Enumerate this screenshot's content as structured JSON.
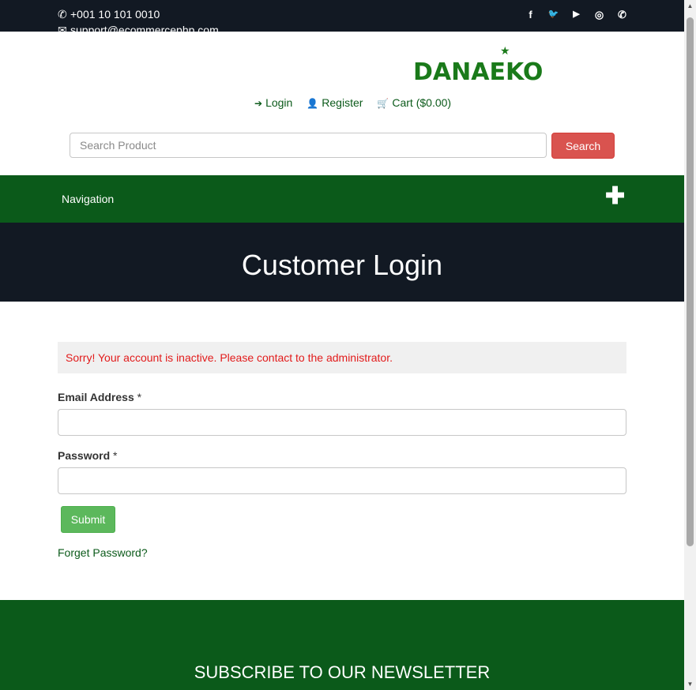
{
  "topbar": {
    "phone": "+001 10 101 0010",
    "email": "support@ecommercephp.com",
    "social": [
      {
        "icon": "facebook-icon",
        "glyph": "f"
      },
      {
        "icon": "twitter-icon",
        "glyph": "🐦"
      },
      {
        "icon": "youtube-icon",
        "glyph": "▶"
      },
      {
        "icon": "instagram-icon",
        "glyph": "◎"
      },
      {
        "icon": "whatsapp-icon",
        "glyph": "✆"
      }
    ]
  },
  "header": {
    "logo_text": "DANAEKO",
    "login_label": "Login",
    "register_label": "Register",
    "cart_label": "Cart ($0.00)"
  },
  "search": {
    "placeholder": "Search Product",
    "value": "",
    "button_label": "Search"
  },
  "nav": {
    "label": "Navigation",
    "toggle": "✚"
  },
  "banner": {
    "title": "Customer Login"
  },
  "login": {
    "error_message": "Sorry! Your account is inactive. Please contact to the administrator.",
    "email_label": "Email Address",
    "email_value": "",
    "password_label": "Password",
    "password_value": "",
    "required_marker": "*",
    "submit_label": "Submit",
    "forget_label": "Forget Password?"
  },
  "footer": {
    "newsletter_title": "SUBSCRIBE TO OUR NEWSLETTER"
  },
  "colors": {
    "brand_green": "#0b5a1a",
    "dark_navy": "#121923",
    "search_red": "#d9534f",
    "submit_green": "#5cb85c",
    "error_red": "#e21b1b"
  }
}
